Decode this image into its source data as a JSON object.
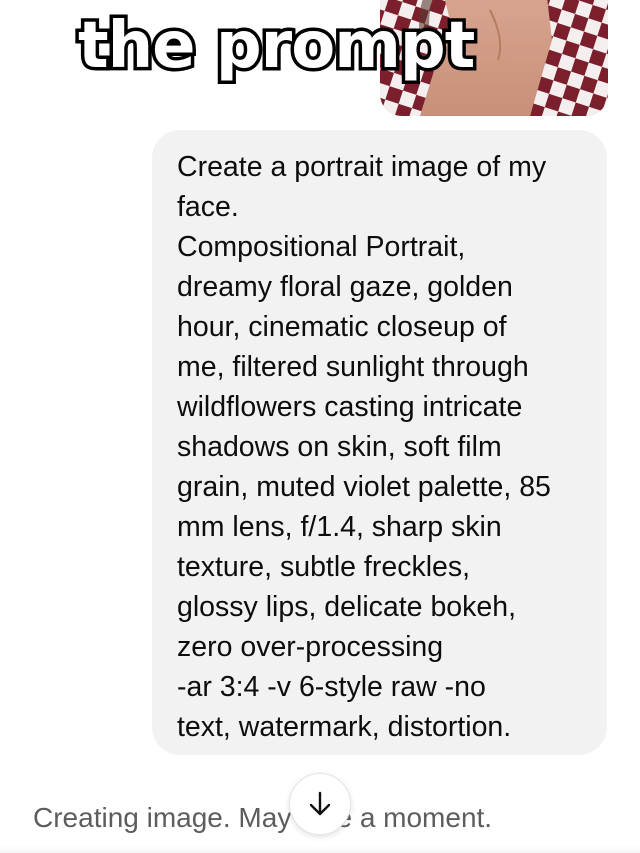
{
  "overlay": {
    "title": "the prompt"
  },
  "photo": {
    "icon": "attached-photo-thumbnail"
  },
  "message": {
    "text": "Create a portrait image of my\nface.\nCompositional Portrait,\ndreamy floral gaze, golden\nhour, cinematic closeup of\nme, filtered sunlight through\nwildflowers casting intricate\nshadows on skin, soft film\ngrain, muted violet palette, 85\nmm lens, f/1.4, sharp skin\ntexture, subtle freckles,\nglossy lips, delicate bokeh,\nzero over-processing\n-ar 3:4 -v 6-style raw -no\ntext, watermark, distortion."
  },
  "status": {
    "text": "Creating image. May take a moment."
  },
  "scroll_button": {
    "icon": "arrow-down-icon"
  },
  "colors": {
    "bubble": "#f2f2f2",
    "status_text": "#5d5d5d",
    "message_text": "#0d0d0d"
  }
}
